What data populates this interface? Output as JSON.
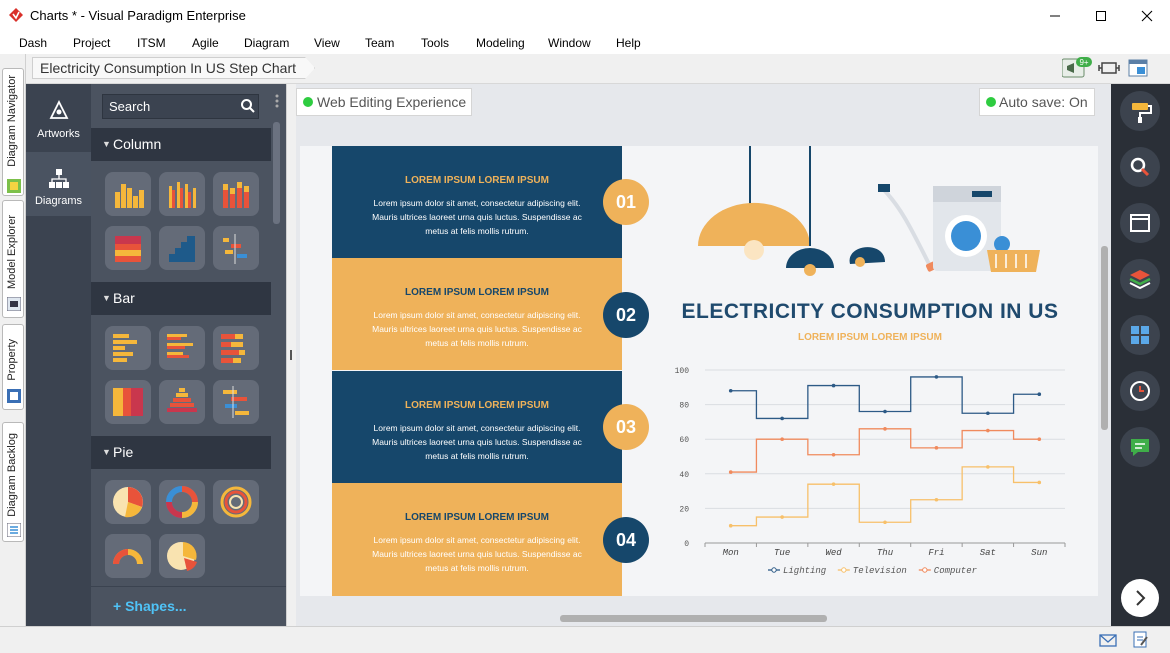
{
  "window": {
    "title": "Charts * - Visual Paradigm Enterprise"
  },
  "menu": [
    "Dash",
    "Project",
    "ITSM",
    "Agile",
    "Diagram",
    "View",
    "Team",
    "Tools",
    "Modeling",
    "Window",
    "Help"
  ],
  "breadcrumb": "Electricity Consumption In US Step Chart",
  "notification_badge": "9+",
  "vertical_tabs": [
    "Diagram Navigator",
    "Model Explorer",
    "Property",
    "Diagram Backlog"
  ],
  "nav": {
    "artworks": "Artworks",
    "diagrams": "Diagrams"
  },
  "palette": {
    "search_placeholder": "Search",
    "sections": [
      "Column",
      "Bar",
      "Pie"
    ],
    "shapes_link": "Shapes..."
  },
  "canvas": {
    "web_editing": "Web Editing Experience",
    "autosave": "Auto save: On"
  },
  "infographic": {
    "steps": [
      {
        "number": "01",
        "title": "LOREM IPSUM LOREM IPSUM",
        "body": "Lorem ipsum dolor sit amet, consectetur adipiscing elit. Mauris ultrices laoreet urna quis luctus. Suspendisse ac metus at felis mollis rutrum."
      },
      {
        "number": "02",
        "title": "LOREM IPSUM LOREM IPSUM",
        "body": "Lorem ipsum dolor sit amet, consectetur adipiscing elit. Mauris ultrices laoreet urna quis luctus. Suspendisse ac metus at felis mollis rutrum."
      },
      {
        "number": "03",
        "title": "LOREM IPSUM LOREM IPSUM",
        "body": "Lorem ipsum dolor sit amet, consectetur adipiscing elit. Mauris ultrices laoreet urna quis luctus. Suspendisse ac metus at felis mollis rutrum."
      },
      {
        "number": "04",
        "title": "LOREM IPSUM LOREM IPSUM",
        "body": "Lorem ipsum dolor sit amet, consectetur adipiscing elit. Mauris ultrices laoreet urna quis luctus. Suspendisse ac metus at felis mollis rutrum."
      }
    ],
    "title": "ELECTRICITY CONSUMPTION IN US",
    "subtitle": "LOREM IPSUM LOREM IPSUM"
  },
  "colors": {
    "navy": "#16476b",
    "gold": "#efb25a",
    "orange": "#f08a5d",
    "dock": "#2a2f37"
  },
  "chart_data": {
    "type": "line",
    "step": true,
    "categories": [
      "Mon",
      "Tue",
      "Wed",
      "Thu",
      "Fri",
      "Sat",
      "Sun"
    ],
    "ylim": [
      0,
      100
    ],
    "yticks": [
      "0",
      "20",
      "40",
      "60",
      "80",
      "100"
    ],
    "grid": true,
    "legend": "bottom",
    "series": [
      {
        "name": "Lighting",
        "color": "#2d5a86",
        "values": [
          88,
          72,
          91,
          76,
          96,
          75,
          86
        ]
      },
      {
        "name": "Television",
        "color": "#f7c06a",
        "values": [
          10,
          15,
          34,
          12,
          25,
          44,
          35
        ]
      },
      {
        "name": "Computer",
        "color": "#f08a5d",
        "values": [
          41,
          60,
          51,
          66,
          55,
          65,
          60
        ]
      }
    ]
  }
}
